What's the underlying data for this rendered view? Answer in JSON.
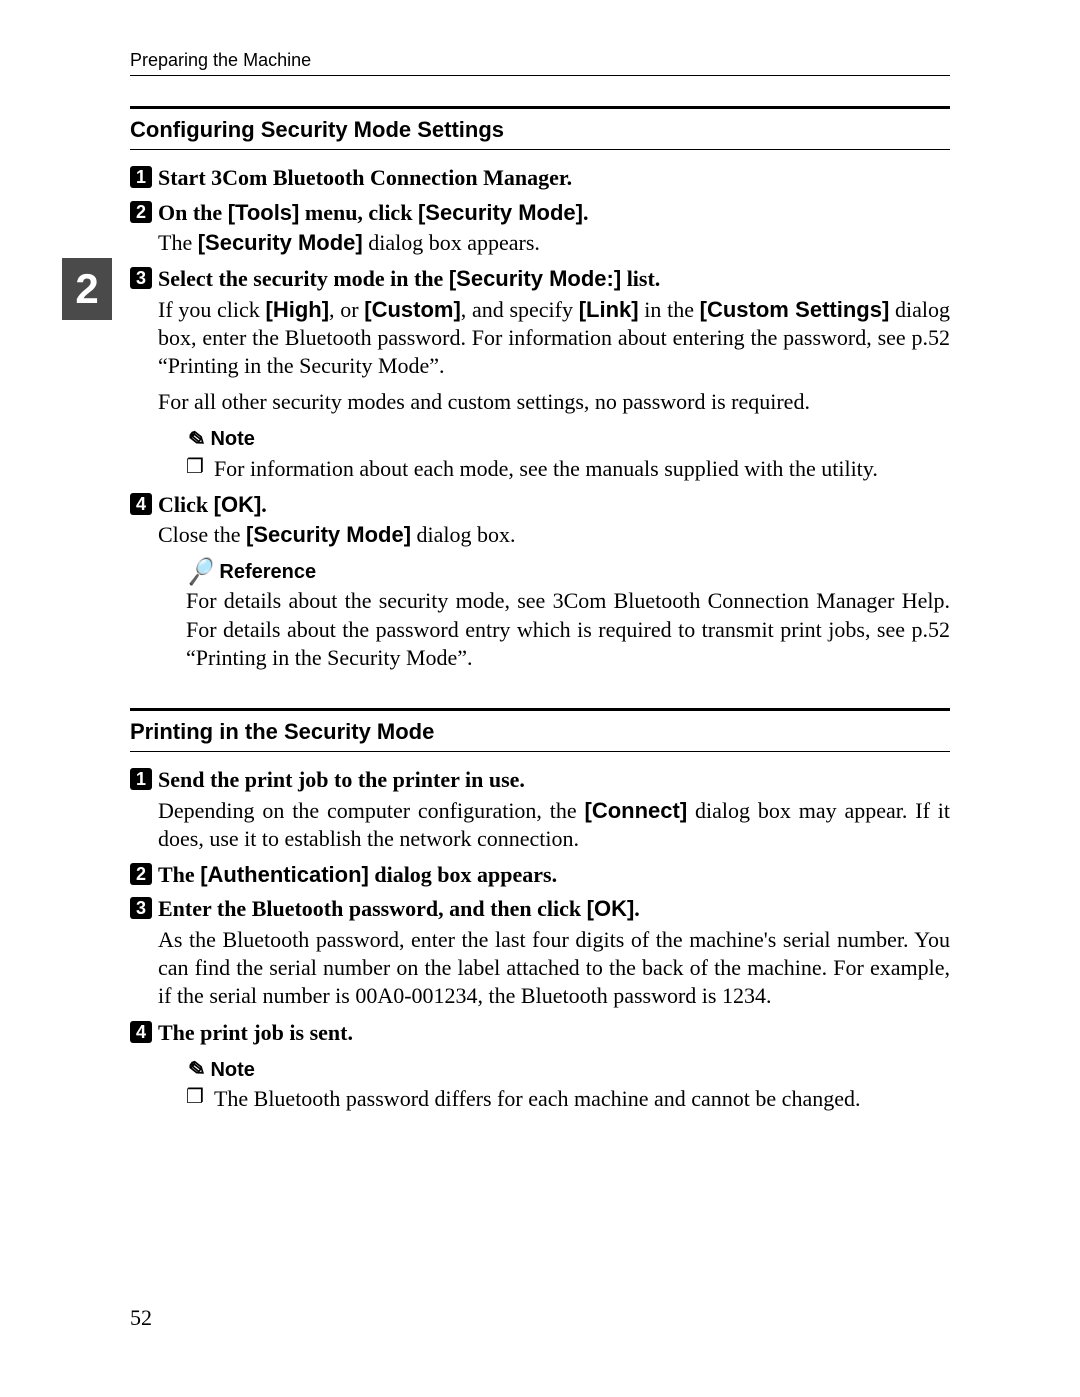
{
  "running_head": "Preparing the Machine",
  "section_tab": "2",
  "page_number": "52",
  "note_label": "Note",
  "reference_label": "Reference",
  "sec1": {
    "title": "Configuring Security Mode Settings",
    "step1": {
      "num": "1",
      "text_parts": [
        "Start 3Com Bluetooth Connection Manager."
      ]
    },
    "step2": {
      "num": "2",
      "text_parts": [
        "On the ",
        "[Tools]",
        " menu, click ",
        "[Security Mode]",
        "."
      ],
      "body_parts": [
        "The ",
        "[Security Mode]",
        " dialog box appears."
      ]
    },
    "step3": {
      "num": "3",
      "text_parts": [
        "Select the security mode in the ",
        "[Security Mode:]",
        " list."
      ],
      "body1_parts": [
        "If you click ",
        "[High]",
        ", or ",
        "[Custom]",
        ", and specify ",
        "[Link]",
        " in the ",
        "[Custom Settings]",
        " dialog box, enter the Bluetooth password. For information about entering the password, see p.52 “Printing in the Security Mode”."
      ],
      "body2": "For all other security modes and custom settings, no password is required.",
      "note_item": "For information about each mode, see the manuals supplied with the utility."
    },
    "step4": {
      "num": "4",
      "text_parts": [
        "Click ",
        "[OK]",
        "."
      ],
      "body_parts": [
        "Close the ",
        "[Security Mode]",
        " dialog box."
      ],
      "reference_text": "For details about the security mode, see 3Com Bluetooth Connection Manager Help. For details about the password entry which is required to transmit print jobs, see p.52 “Printing in the Security Mode”."
    }
  },
  "sec2": {
    "title": "Printing in the Security Mode",
    "step1": {
      "num": "1",
      "text_parts": [
        "Send the print job to the printer in use."
      ],
      "body_parts": [
        "Depending on the computer configuration, the ",
        "[Connect]",
        " dialog box may appear. If it does, use it to establish the network connection."
      ]
    },
    "step2": {
      "num": "2",
      "text_parts": [
        "The ",
        "[Authentication]",
        " dialog box appears."
      ]
    },
    "step3": {
      "num": "3",
      "text_parts": [
        "Enter the Bluetooth password, and then click ",
        "[OK]",
        "."
      ],
      "body": "As the Bluetooth password, enter the last four digits of the machine's serial number. You can find the serial number on the label attached to the back of the machine. For example, if the serial number is 00A0-001234, the Bluetooth password is 1234."
    },
    "step4": {
      "num": "4",
      "text_parts": [
        "The print job is sent."
      ],
      "note_item": "The Bluetooth password differs for each machine and cannot be changed."
    }
  }
}
